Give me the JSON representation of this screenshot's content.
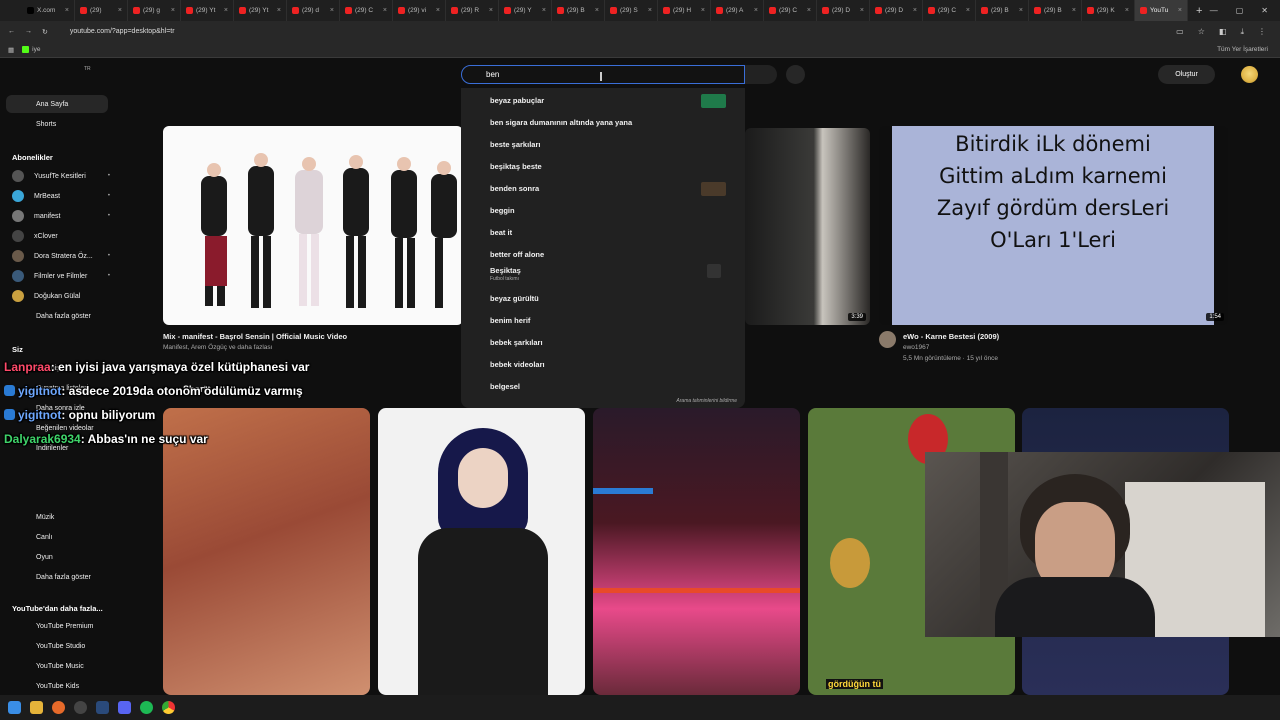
{
  "tabs": [
    {
      "label": "X.com",
      "active": false
    },
    {
      "label": "(29) ",
      "active": false
    },
    {
      "label": "(29) g",
      "active": false
    },
    {
      "label": "(29) Yt",
      "active": false
    },
    {
      "label": "(29) Yt",
      "active": false
    },
    {
      "label": "(29) d",
      "active": false
    },
    {
      "label": "(29) C",
      "active": false
    },
    {
      "label": "(29) vi",
      "active": false
    },
    {
      "label": "(29) R",
      "active": false
    },
    {
      "label": "(29) Y",
      "active": false
    },
    {
      "label": "(29) B",
      "active": false
    },
    {
      "label": "(29) S",
      "active": false
    },
    {
      "label": "(29) H",
      "active": false
    },
    {
      "label": "(29) A",
      "active": false
    },
    {
      "label": "(29) C",
      "active": false
    },
    {
      "label": "(29) D",
      "active": false
    },
    {
      "label": "(29) D",
      "active": false
    },
    {
      "label": "(29) C",
      "active": false
    },
    {
      "label": "(29) B",
      "active": false
    },
    {
      "label": "(29) B",
      "active": false
    },
    {
      "label": "(29) K",
      "active": false
    },
    {
      "label": "YouTu",
      "active": true
    }
  ],
  "browser": {
    "url": "youtube.com/?app=desktop&hl=tr",
    "bookmark_label": "iye",
    "all_bookmarks": "Tüm Yer İşaretleri"
  },
  "header": {
    "country_code": "TR",
    "search_query": "ben",
    "create_label": "Oluştur"
  },
  "suggestions": {
    "items": [
      {
        "text": "beyaz pabuçlar",
        "thumb": true
      },
      {
        "text": "ben sigara dumanının altında yana yana",
        "thumb": false
      },
      {
        "text": "beste şarkıları",
        "thumb": false
      },
      {
        "text": "beşiktaş beste",
        "thumb": false
      },
      {
        "text": "benden sonra",
        "thumb": true
      },
      {
        "text": "beggin",
        "thumb": false
      },
      {
        "text": "beat it",
        "thumb": false
      },
      {
        "text": "better off alone",
        "thumb": false
      },
      {
        "text": "Beşiktaş",
        "sub": "Futbol takımı",
        "thumb": true
      },
      {
        "text": "beyaz gürültü",
        "thumb": false
      },
      {
        "text": "benim herif",
        "thumb": false
      },
      {
        "text": "bebek şarkıları",
        "thumb": false
      },
      {
        "text": "bebek videoları",
        "thumb": false
      },
      {
        "text": "belgesel",
        "thumb": false
      }
    ],
    "footer": "Arama tahminlerini bildirme"
  },
  "sidebar": {
    "main": [
      {
        "label": "Ana Sayfa",
        "active": true
      },
      {
        "label": "Shorts",
        "active": false
      }
    ],
    "subscriptions_heading": "Abonelikler",
    "subscriptions": [
      {
        "label": "YusufTe Kesitleri",
        "color": "#555",
        "dot": "•"
      },
      {
        "label": "MrBeast",
        "color": "#3aa6d8",
        "dot": "•"
      },
      {
        "label": "manifest",
        "color": "#777",
        "dot": "•"
      },
      {
        "label": "xClover",
        "color": "#444",
        "dot": ""
      },
      {
        "label": "Dora Stratera Öz...",
        "color": "#6a5a4a",
        "dot": "•"
      },
      {
        "label": "Filmler ve Filmler",
        "color": "#3a5a7a",
        "dot": "•"
      },
      {
        "label": "Doğukan Gülal",
        "color": "#c9a040",
        "dot": ""
      }
    ],
    "more_subs": "Daha fazla göster",
    "you_heading": "Siz",
    "you_items": [
      "Geçmiş",
      "Oynatma listeleri",
      "Daha sonra izle",
      "Beğenilen videolar",
      "İndirilenler"
    ],
    "explore_items": [
      "Müzik",
      "Canlı",
      "Oyun",
      "Daha fazla göster"
    ],
    "more_heading": "YouTube'dan daha fazla...",
    "more_items": [
      "YouTube Premium",
      "YouTube Studio",
      "YouTube Music",
      "YouTube Kids"
    ]
  },
  "videos": [
    {
      "title": "Mix - manifest - Başrol Sensin | Official Music Video",
      "meta1": "Manifest, Arem Özgüç ve daha fazlası",
      "meta2": ""
    },
    {
      "title": "",
      "meta1": "",
      "meta2": "",
      "duration": "3:39"
    },
    {
      "title": "eWo - Karne Bestesi (2009)",
      "meta1": "ewo1967",
      "meta2": "5,5 Mn görüntüleme · 15 yıl önce",
      "duration": "1:54",
      "thumb_text": [
        "Bitirdik iLk dönemi",
        "Gittim aLdım karnemi",
        "Zayıf gördüm dersLeri",
        "O'Ları 1'Leri"
      ]
    }
  ],
  "shorts": {
    "heading": "Shorts",
    "caption": "gördüğün tü"
  },
  "chat": [
    {
      "user": "Lanpraa",
      "text": ": en iyisi java yarışmaya özel kütüphanesi var",
      "color": "#ff4a6a",
      "badge": false
    },
    {
      "user": "yigitnot",
      "text": ": asdece 2019da otonom ödülümüz varmış",
      "color": "#6ea8ff",
      "badge": true
    },
    {
      "user": "yigitnot",
      "text": ": opnu biliyorum",
      "color": "#6ea8ff",
      "badge": true
    },
    {
      "user": "Dalyarak6934",
      "text": ": Abbas'ın ne suçu var",
      "color": "#3fd46a",
      "badge": false
    }
  ]
}
